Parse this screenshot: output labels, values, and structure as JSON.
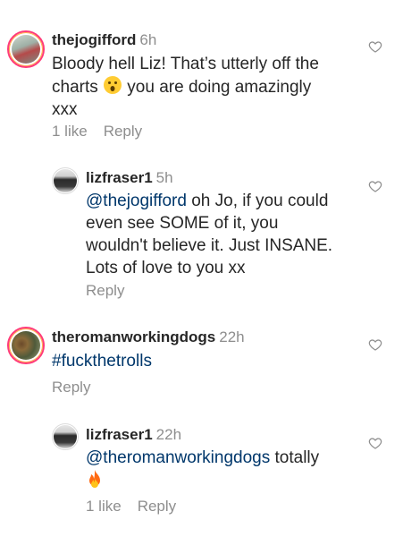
{
  "comments": [
    {
      "username": "thejogifford",
      "time": "6h",
      "text_lines": [
        "Bloody hell Liz! That’s utterly off the",
        "charts",
        " you are doing amazingly",
        "xxx"
      ],
      "likes": "1 like",
      "reply": "Reply"
    },
    {
      "username": "lizfraser1",
      "time": "5h",
      "mention": "@thejogifford",
      "text_lines": [
        " oh Jo, if you could",
        "even see SOME of it, you",
        "wouldn't believe it. Just INSANE.",
        "Lots of love to you xx"
      ],
      "reply": "Reply"
    },
    {
      "username": "theromanworkingdogs",
      "time": "22h",
      "hashtag": "#fuckthetrolls",
      "reply": "Reply"
    },
    {
      "username": "lizfraser1",
      "time": "22h",
      "mention": "@theromanworkingdogs",
      "text_lines": [
        " totally"
      ],
      "likes": "1 like",
      "reply": "Reply"
    }
  ],
  "icons": {
    "like": "heart-outline-icon",
    "surprised_emoji": "face-open-mouth-emoji",
    "fire_emoji": "fire-emoji"
  },
  "colors": {
    "text": "#262626",
    "secondary": "#8e8e8e",
    "link": "#00376b",
    "story_ring": "#ff3b7a"
  }
}
